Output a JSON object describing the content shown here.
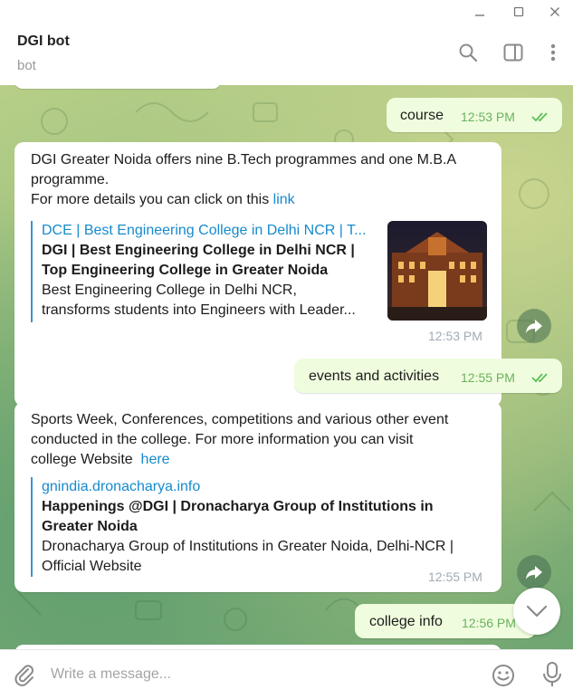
{
  "window": {
    "minimize_glyph": "—",
    "maximize_glyph": "□",
    "close_glyph": "✕"
  },
  "header": {
    "title": "DGI bot",
    "subtitle": "bot",
    "icons": [
      "search-icon",
      "sidebar-toggle-icon",
      "more-vertical-icon"
    ]
  },
  "messages": {
    "m1": {
      "text": "course",
      "time": "12:53 PM"
    },
    "m2": {
      "line1": "DGI Greater Noida offers nine B.Tech programmes and one M.B.A",
      "line2": "programme.",
      "line3_prefix": "For more details you can click on this",
      "link": "link",
      "preview_site": "DCE | Best Engineering College in Delhi NCR | T...",
      "preview_title_1": "DGI | Best Engineering College in Delhi NCR |",
      "preview_title_2": "Top Engineering College in Greater Noida",
      "preview_desc_1": "Best Engineering College in Delhi NCR,",
      "preview_desc_2": "transforms students into Engineers with Leader...",
      "time": "12:53 PM"
    },
    "m3": {
      "text": "events and activities",
      "time": "12:55 PM"
    },
    "m4": {
      "line1": "Sports Week, Conferences, competitions and various other event",
      "line2": "conducted in the college. For more information you can visit",
      "line3_prefix": "college Website",
      "link": "here",
      "preview_site": "gnindia.dronacharya.info",
      "preview_title_1": "Happenings @DGI | Dronacharya Group of Institutions in",
      "preview_title_2": "Greater Noida",
      "preview_desc_1": "Dronacharya Group of Institutions in Greater Noida, Delhi-NCR |",
      "preview_desc_2": "Official Website",
      "time": "12:55 PM"
    },
    "m5": {
      "text": "college info",
      "time": "12:56 PM"
    }
  },
  "composer": {
    "placeholder": "Write a message..."
  },
  "colors": {
    "link": "#168acd",
    "outgoing_bubble": "#effdde",
    "check": "#5ebf59"
  }
}
